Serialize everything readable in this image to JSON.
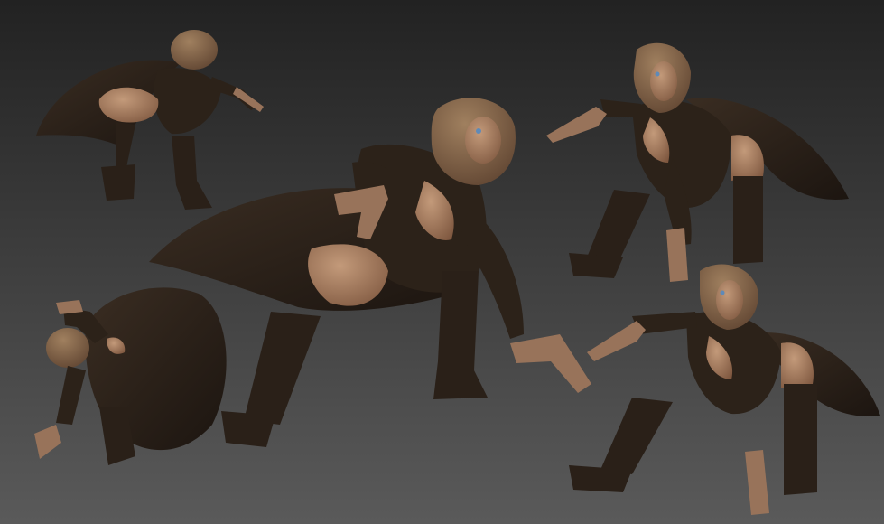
{
  "scene": {
    "description_free": true,
    "colors": {
      "bg_top": "#222222",
      "bg_bottom": "#5a5a5a",
      "coat": "#2c2219",
      "coat_shade": "#1f1812",
      "cape": "#2a2119",
      "skin": "#b08667",
      "skin_shade": "#8a6148",
      "hair": "#8c6a4f",
      "hair_shade": "#6d4f39",
      "boot": "#2a2018",
      "gun": "#98735a",
      "eye": "#5f8ab8"
    },
    "figures": [
      {
        "id": "view-back-top-left"
      },
      {
        "id": "view-front-center"
      },
      {
        "id": "view-front-top-right"
      },
      {
        "id": "view-top-down-bottom-left"
      },
      {
        "id": "view-front-bottom-right"
      }
    ]
  }
}
